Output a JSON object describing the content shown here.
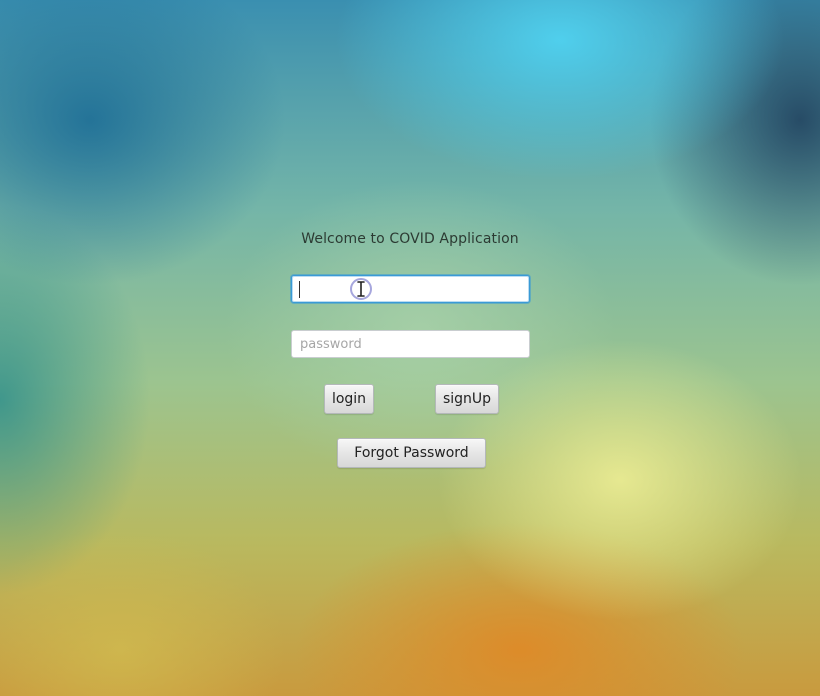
{
  "login_form": {
    "welcome_text": "Welcome to COVID Application",
    "username": {
      "value": "",
      "placeholder": ""
    },
    "password": {
      "value": "",
      "placeholder": "password"
    },
    "login_label": "login",
    "signup_label": "signUp",
    "forgot_label": "Forgot Password"
  },
  "cursor": {
    "icon": "i-beam-text-cursor-icon"
  },
  "colors": {
    "focus_border": "#3a9ad6",
    "text": "#2c3b33"
  }
}
